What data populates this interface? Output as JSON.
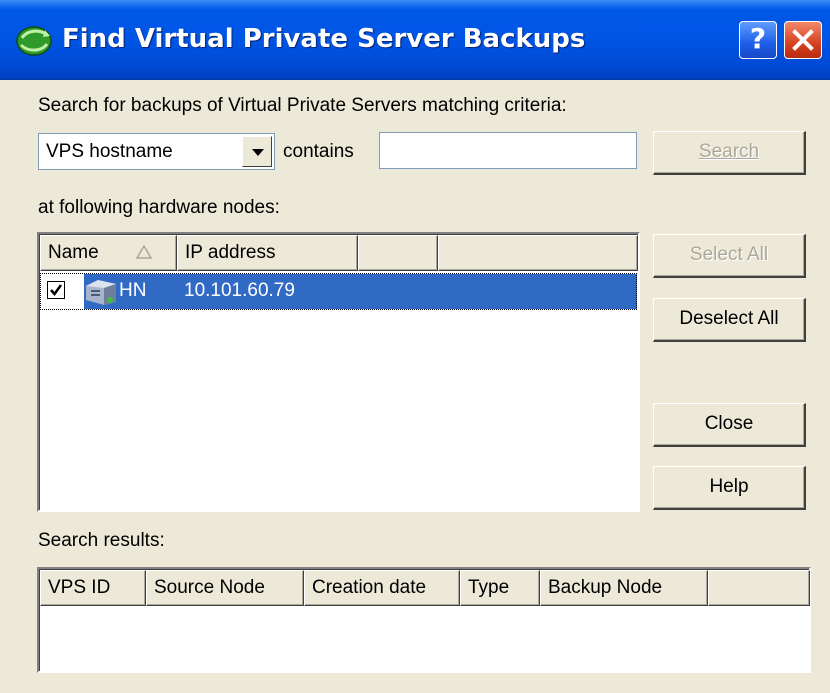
{
  "window": {
    "title": "Find Virtual Private Server Backups",
    "help_glyph": "?",
    "close_icon": "close-x-icon",
    "app_icon": "backup-globe-icon"
  },
  "search": {
    "prompt": "Search for backups of Virtual Private Servers matching criteria:",
    "field_selected": "VPS hostname",
    "operator": "contains",
    "query_value": "",
    "search_button": "Search",
    "search_button_enabled": false
  },
  "nodes": {
    "label": "at following hardware nodes:",
    "columns": [
      "Name",
      "IP address",
      "",
      ""
    ],
    "sort_column": "Name",
    "sort_direction": "ascending",
    "rows": [
      {
        "name": "HN",
        "ip": "10.101.60.79",
        "checked": true,
        "selected": true,
        "icon": "server-icon"
      }
    ],
    "select_all": "Select All",
    "select_all_enabled": false,
    "deselect_all": "Deselect All"
  },
  "actions": {
    "close": "Close",
    "help": "Help"
  },
  "results": {
    "label": "Search results:",
    "columns": [
      "VPS ID",
      "Source Node",
      "Creation date",
      "Type",
      "Backup Node",
      ""
    ],
    "rows": []
  },
  "colors": {
    "titlebar": "#0055e5",
    "dialog_bg": "#ece9d8",
    "selection": "#316ac5",
    "disabled_text": "#aca899"
  }
}
